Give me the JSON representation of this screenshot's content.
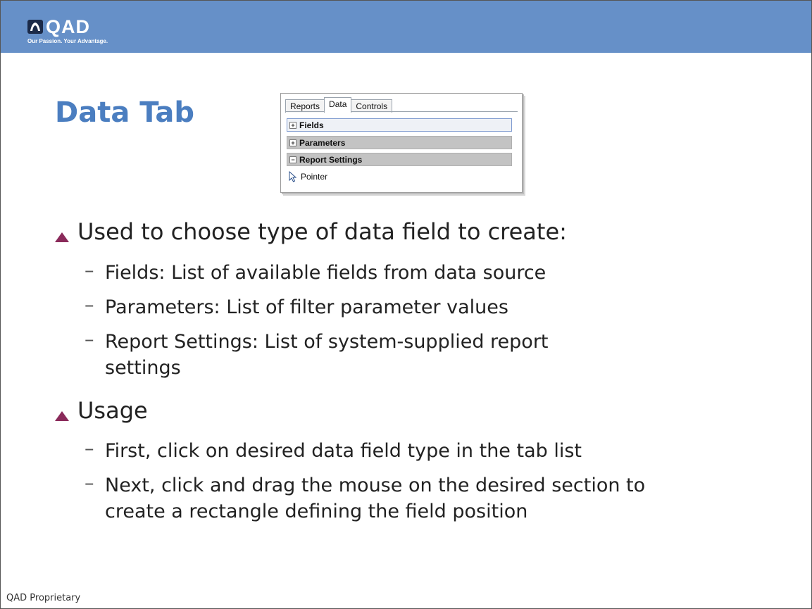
{
  "brand": {
    "logo_text": "QAD",
    "tagline": "Our Passion. Your Advantage.",
    "header_color": "#6690c8"
  },
  "slide": {
    "title": "Data Tab"
  },
  "panel": {
    "tabs": [
      "Reports",
      "Data",
      "Controls"
    ],
    "active_tab": "Data",
    "sections": [
      {
        "toggle": "+",
        "label": "Fields"
      },
      {
        "toggle": "+",
        "label": "Parameters"
      },
      {
        "toggle": "−",
        "label": "Report Settings"
      }
    ],
    "pointer_label": "Pointer"
  },
  "bullets": [
    {
      "text": "Used to choose type of data field to create:",
      "subs": [
        {
          "text": "Fields: List of available fields from data source"
        },
        {
          "text": "Parameters: List of filter parameter values"
        },
        {
          "text": "Report Settings: List of system-supplied report settings"
        }
      ]
    },
    {
      "text": "Usage",
      "subs": [
        {
          "text": "First, click on desired data field type in the tab list"
        },
        {
          "text": "Next, click and drag the mouse on the desired section to create a rectangle defining the field position"
        }
      ]
    }
  ],
  "footer": {
    "text": "QAD Proprietary"
  },
  "colors": {
    "title": "#4b7ec0",
    "bullet_marker": "#8a2a5a"
  }
}
